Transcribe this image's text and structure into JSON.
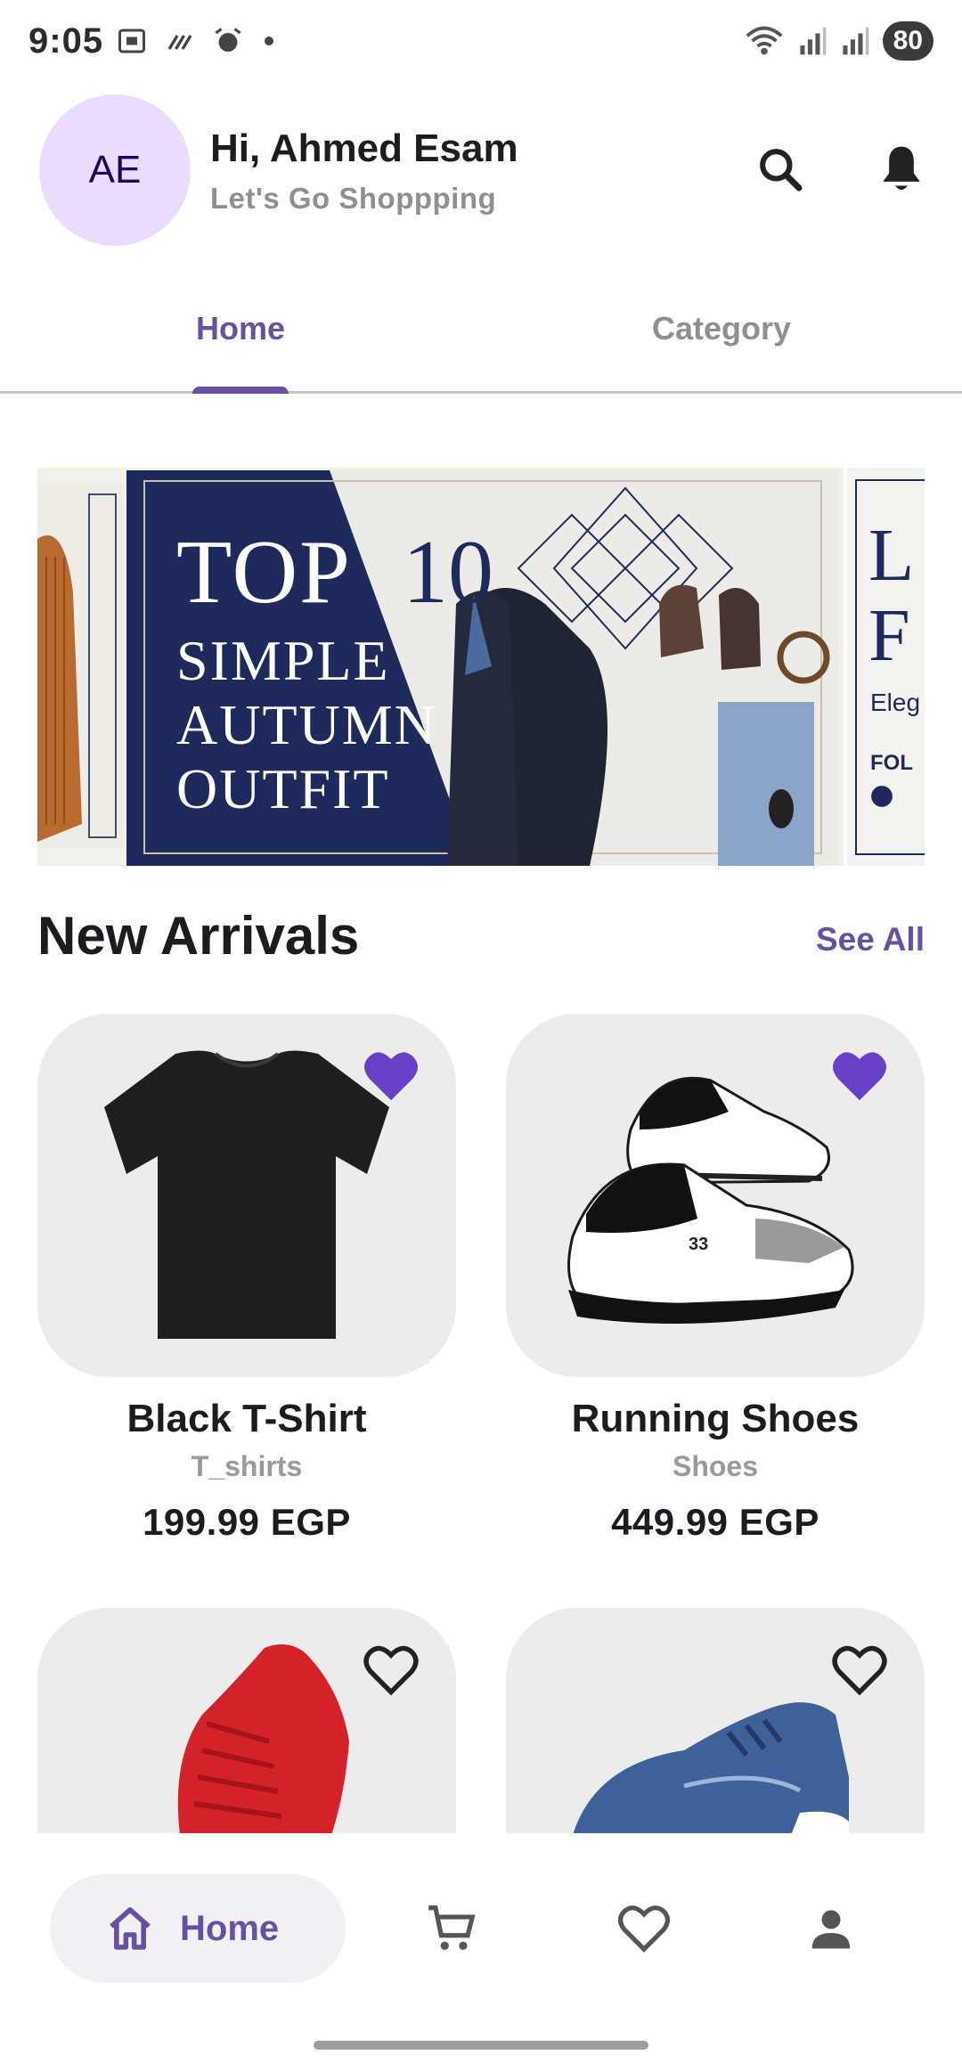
{
  "status_bar": {
    "time": "9:05",
    "battery": "80",
    "icons_left": [
      "screenshot-icon",
      "mute-icon",
      "alarm-icon",
      "dot-icon"
    ],
    "icons_right": [
      "wifi-icon",
      "signal-icon",
      "signal-icon"
    ]
  },
  "header": {
    "avatar_initials": "AE",
    "greeting": "Hi, Ahmed Esam",
    "subtitle": "Let's Go Shoppping",
    "actions": [
      "search-icon",
      "bell-icon"
    ]
  },
  "tabs": [
    {
      "label": "Home",
      "selected": true
    },
    {
      "label": "Category",
      "selected": false
    }
  ],
  "banner": {
    "line_top": "TOP",
    "line_ten": "10",
    "line_1": "SIMPLE",
    "line_2": "AUTUMN",
    "line_3": "OUTFIT",
    "peek_right_l1": "L",
    "peek_right_l2": "F",
    "peek_right_sub": "Eleg",
    "peek_right_fol": "FOL"
  },
  "section": {
    "title": "New Arrivals",
    "see_all": "See All"
  },
  "products": [
    {
      "name": "Black T-Shirt",
      "category": "T_shirts",
      "price": "199.99 EGP",
      "favorite": true,
      "image": "black-tshirt"
    },
    {
      "name": "Running Shoes",
      "category": "Shoes",
      "price": "449.99 EGP",
      "favorite": true,
      "image": "running-shoes"
    },
    {
      "favorite": false,
      "image": "red-sneaker"
    },
    {
      "favorite": false,
      "image": "blue-sneaker"
    }
  ],
  "bottom_nav": [
    {
      "label": "Home",
      "icon": "home-icon",
      "selected": true
    },
    {
      "icon": "cart-icon",
      "selected": false
    },
    {
      "icon": "heart-icon",
      "selected": false
    },
    {
      "icon": "person-icon",
      "selected": false
    }
  ],
  "colors": {
    "accent": "#6750a4",
    "favorite": "#6a3fc8",
    "avatar_bg": "#eadcff",
    "banner_navy": "#1f2a5c"
  }
}
